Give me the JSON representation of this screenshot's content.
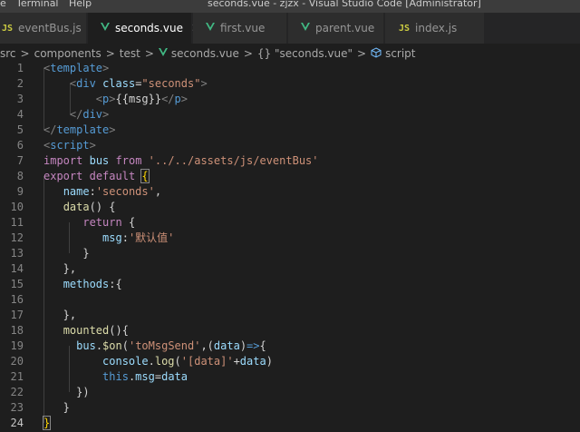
{
  "menu": [
    {
      "label": "File",
      "display": "e"
    },
    {
      "label": "Terminal",
      "display": "Terminal"
    },
    {
      "label": "Help",
      "display": "Help"
    }
  ],
  "window_title": "seconds.vue - zjzx - Visual Studio Code [Administrator]",
  "tabs": [
    {
      "icon": "JS",
      "icon_name": "javascript-file-icon",
      "label": "eventBus.js",
      "active": false
    },
    {
      "icon": "V",
      "icon_name": "vue-file-icon",
      "label": "seconds.vue",
      "active": true
    },
    {
      "icon": "V",
      "icon_name": "vue-file-icon",
      "label": "first.vue",
      "active": false
    },
    {
      "icon": "V",
      "icon_name": "vue-file-icon",
      "label": "parent.vue",
      "active": false
    },
    {
      "icon": "JS",
      "icon_name": "javascript-file-icon",
      "label": "index.js",
      "active": false
    }
  ],
  "breadcrumb": {
    "items": [
      "src",
      "components",
      "test",
      "seconds.vue",
      "{} \"seconds.vue\"",
      "script"
    ],
    "separator": ">"
  },
  "editor": {
    "current_line": 24,
    "lines": [
      {
        "n": "1",
        "tokens": [
          [
            "t-punc",
            "<"
          ],
          [
            "t-tag",
            "template"
          ],
          [
            "t-punc",
            ">"
          ]
        ]
      },
      {
        "n": "2",
        "tokens": [
          [
            "t-plain",
            "    "
          ],
          [
            "t-punc",
            "<"
          ],
          [
            "t-tag",
            "div"
          ],
          [
            "t-plain",
            " "
          ],
          [
            "t-attr",
            "class"
          ],
          [
            "t-plain",
            "="
          ],
          [
            "t-str",
            "\"seconds\""
          ],
          [
            "t-punc",
            ">"
          ]
        ]
      },
      {
        "n": "3",
        "tokens": [
          [
            "t-plain",
            "        "
          ],
          [
            "t-punc",
            "<"
          ],
          [
            "t-tag",
            "p"
          ],
          [
            "t-punc",
            ">"
          ],
          [
            "t-plain",
            "{{msg}}"
          ],
          [
            "t-punc",
            "</"
          ],
          [
            "t-tag",
            "p"
          ],
          [
            "t-punc",
            ">"
          ]
        ]
      },
      {
        "n": "4",
        "tokens": [
          [
            "t-plain",
            "    "
          ],
          [
            "t-punc",
            "</"
          ],
          [
            "t-tag",
            "div"
          ],
          [
            "t-punc",
            ">"
          ]
        ]
      },
      {
        "n": "5",
        "tokens": [
          [
            "t-punc",
            "</"
          ],
          [
            "t-tag",
            "template"
          ],
          [
            "t-punc",
            ">"
          ]
        ]
      },
      {
        "n": "6",
        "tokens": [
          [
            "t-punc",
            "<"
          ],
          [
            "t-tag",
            "script"
          ],
          [
            "t-punc",
            ">"
          ]
        ]
      },
      {
        "n": "7",
        "tokens": [
          [
            "t-kw",
            "import"
          ],
          [
            "t-plain",
            " "
          ],
          [
            "t-var",
            "bus"
          ],
          [
            "t-plain",
            " "
          ],
          [
            "t-kw",
            "from"
          ],
          [
            "t-plain",
            " "
          ],
          [
            "t-str",
            "'../../assets/js/eventBus'"
          ]
        ]
      },
      {
        "n": "8",
        "tokens": [
          [
            "t-kw",
            "export"
          ],
          [
            "t-plain",
            " "
          ],
          [
            "t-kw",
            "default"
          ],
          [
            "t-plain",
            " "
          ],
          [
            "t-yel",
            "{"
          ]
        ]
      },
      {
        "n": "9",
        "tokens": [
          [
            "t-plain",
            "   "
          ],
          [
            "t-var",
            "name"
          ],
          [
            "t-plain",
            ":"
          ],
          [
            "t-str",
            "'seconds'"
          ],
          [
            "t-plain",
            ","
          ]
        ]
      },
      {
        "n": "10",
        "tokens": [
          [
            "t-plain",
            "   "
          ],
          [
            "t-fn",
            "data"
          ],
          [
            "t-plain",
            "() {"
          ]
        ]
      },
      {
        "n": "11",
        "tokens": [
          [
            "t-plain",
            "      "
          ],
          [
            "t-kw",
            "return"
          ],
          [
            "t-plain",
            " {"
          ]
        ]
      },
      {
        "n": "12",
        "tokens": [
          [
            "t-plain",
            "         "
          ],
          [
            "t-var",
            "msg"
          ],
          [
            "t-plain",
            ":"
          ],
          [
            "t-str",
            "'默认值'"
          ]
        ]
      },
      {
        "n": "13",
        "tokens": [
          [
            "t-plain",
            "      }"
          ]
        ]
      },
      {
        "n": "14",
        "tokens": [
          [
            "t-plain",
            "   },"
          ]
        ]
      },
      {
        "n": "15",
        "tokens": [
          [
            "t-plain",
            "   "
          ],
          [
            "t-var",
            "methods"
          ],
          [
            "t-plain",
            ":{"
          ]
        ]
      },
      {
        "n": "16",
        "tokens": []
      },
      {
        "n": "17",
        "tokens": [
          [
            "t-plain",
            "   },"
          ]
        ]
      },
      {
        "n": "18",
        "tokens": [
          [
            "t-plain",
            "   "
          ],
          [
            "t-fn",
            "mounted"
          ],
          [
            "t-plain",
            "(){"
          ]
        ]
      },
      {
        "n": "19",
        "tokens": [
          [
            "t-plain",
            "     "
          ],
          [
            "t-var",
            "bus"
          ],
          [
            "t-plain",
            "."
          ],
          [
            "t-fn",
            "$on"
          ],
          [
            "t-plain",
            "("
          ],
          [
            "t-str",
            "'toMsgSend'"
          ],
          [
            "t-plain",
            ",("
          ],
          [
            "t-var",
            "data"
          ],
          [
            "t-plain",
            ")"
          ],
          [
            "t-blue",
            "=>"
          ],
          [
            "t-plain",
            "{"
          ]
        ]
      },
      {
        "n": "20",
        "tokens": [
          [
            "t-plain",
            "         "
          ],
          [
            "t-var",
            "console"
          ],
          [
            "t-plain",
            "."
          ],
          [
            "t-fn",
            "log"
          ],
          [
            "t-plain",
            "("
          ],
          [
            "t-str",
            "'[data]'"
          ],
          [
            "t-plain",
            "+"
          ],
          [
            "t-var",
            "data"
          ],
          [
            "t-plain",
            ")"
          ]
        ]
      },
      {
        "n": "21",
        "tokens": [
          [
            "t-plain",
            "         "
          ],
          [
            "t-blue",
            "this"
          ],
          [
            "t-plain",
            "."
          ],
          [
            "t-var",
            "msg"
          ],
          [
            "t-plain",
            "="
          ],
          [
            "t-var",
            "data"
          ]
        ]
      },
      {
        "n": "22",
        "tokens": [
          [
            "t-plain",
            "     })"
          ]
        ]
      },
      {
        "n": "23",
        "tokens": [
          [
            "t-plain",
            "   }"
          ]
        ]
      },
      {
        "n": "24",
        "tokens": [
          [
            "t-yel",
            "}"
          ]
        ]
      }
    ]
  },
  "colors": {
    "editor_bg": "#1e1e1e",
    "tabbar_bg": "#252526",
    "titlebar_bg": "#3c3c3c",
    "vue_green": "#41b883",
    "js_yellow": "#cbcb41"
  }
}
